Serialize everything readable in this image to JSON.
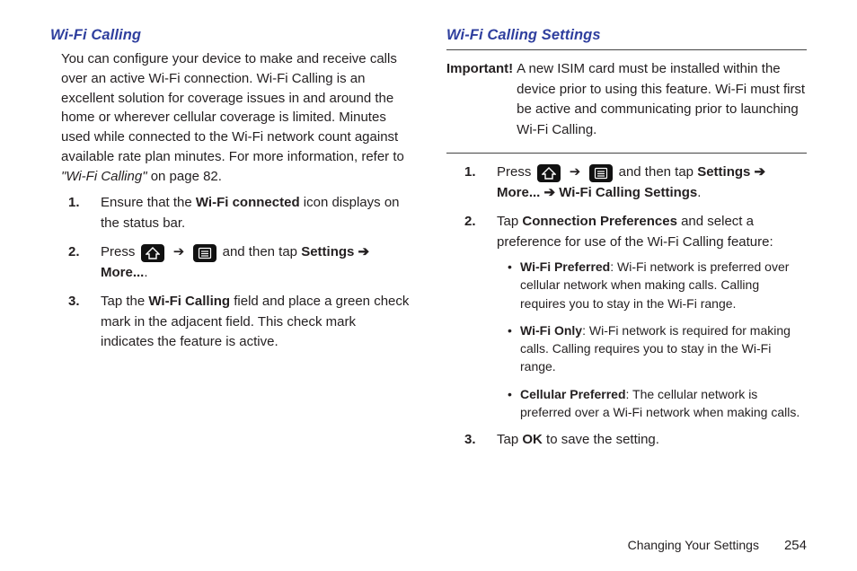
{
  "left": {
    "heading": "Wi-Fi Calling",
    "intro_pre": "You can configure your device to make and receive calls over an active Wi-Fi connection. Wi-Fi Calling is an excellent solution for coverage issues in and around the home or wherever cellular coverage is limited. Minutes used while connected to the Wi-Fi network count against available rate plan minutes. For more information, refer to ",
    "intro_ref": "\"Wi-Fi Calling\"",
    "intro_post": " on page 82.",
    "steps": {
      "s1": {
        "num": "1.",
        "pre": "Ensure that the ",
        "bold": "Wi-Fi connected",
        "post": " icon displays on the status bar."
      },
      "s2": {
        "num": "2.",
        "press": "Press ",
        "then": " and then tap ",
        "settings": "Settings",
        "arrow": " ➔ ",
        "more": "More...",
        "dot": "."
      },
      "s3": {
        "num": "3.",
        "pre": "Tap the ",
        "bold": "Wi-Fi Calling",
        "post": " field and place a green check mark in the adjacent field. This check mark indicates the feature is active."
      }
    }
  },
  "right": {
    "heading": "Wi-Fi Calling Settings",
    "important_label": "Important!",
    "important_text": " A new ISIM card must be installed within the device prior to using this feature. Wi-Fi must first be active and communicating prior to launching Wi-Fi Calling.",
    "steps": {
      "s1": {
        "num": "1.",
        "press": "Press ",
        "then": " and then tap ",
        "settings": "Settings",
        "arrow": " ➔ ",
        "more": "More...",
        "arrow2": " ➔ ",
        "wcs": "Wi-Fi Calling Settings",
        "dot": "."
      },
      "s2": {
        "num": "2.",
        "pre": "Tap ",
        "bold": "Connection Preferences",
        "post": " and select a preference for use of the Wi-Fi Calling feature:",
        "opts": {
          "a": {
            "b": "Wi-Fi Preferred",
            "t": ": Wi-Fi network is preferred over cellular network when making calls. Calling requires you to stay in the Wi-Fi range."
          },
          "b": {
            "b": "Wi-Fi Only",
            "t": ": Wi-Fi network is required for making calls. Calling requires you to stay in the Wi-Fi range."
          },
          "c": {
            "b": "Cellular Preferred",
            "t": ": The cellular network is preferred over a Wi-Fi network when making calls."
          }
        }
      },
      "s3": {
        "num": "3.",
        "pre": "Tap ",
        "bold": "OK",
        "post": " to save the setting."
      }
    }
  },
  "footer": {
    "section": "Changing Your Settings",
    "page": "254"
  },
  "icons": {
    "arrow": "➔"
  }
}
